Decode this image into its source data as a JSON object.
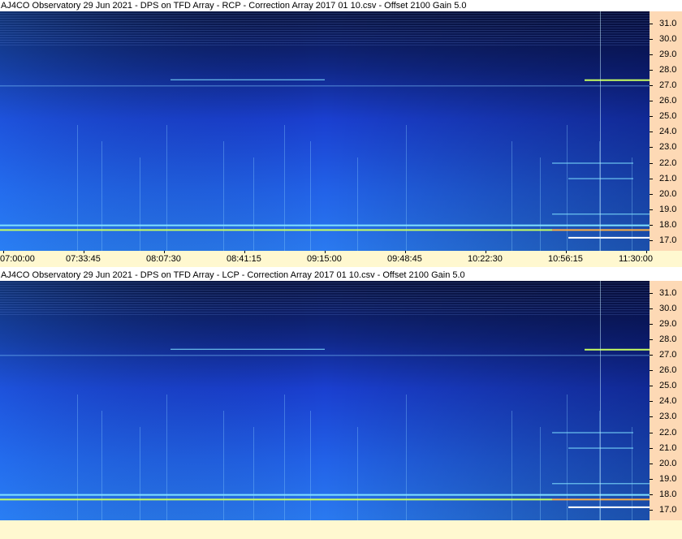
{
  "panels": [
    {
      "title": "AJ4CO Observatory 29 Jun 2021  -  DPS on TFD Array  -  RCP  -  Correction Array 2017 01 10.csv  -  Offset 2100  Gain 5.0",
      "polarization": "RCP"
    },
    {
      "title": "AJ4CO Observatory 29 Jun 2021  -  DPS on TFD Array  -  LCP  -  Correction Array 2017 01 10.csv  -  Offset 2100  Gain 5.0",
      "polarization": "LCP"
    }
  ],
  "colors": {
    "background_dark": "#0a1440",
    "background_mid": "#1a3fd0",
    "background_bright": "#2a7af0",
    "band": "#7fe0ff",
    "band_hot": "#c8ff60",
    "yaxis_bg": "#fdd9b5",
    "xaxis_bg": "#fff8d0"
  },
  "chart_data": [
    {
      "type": "heatmap",
      "title": "AJ4CO Observatory 29 Jun 2021  -  DPS on TFD Array  -  RCP  -  Correction Array 2017 01 10.csv  -  Offset 2100  Gain 5.0",
      "x_tick_labels": [
        "07:00:00",
        "07:33:45",
        "08:07:30",
        "08:41:15",
        "09:15:00",
        "09:48:45",
        "10:22:30",
        "10:56:15",
        "11:30:00"
      ],
      "xlim": [
        "07:00:00",
        "11:30:00"
      ],
      "y_tick_labels": [
        "31.0",
        "30.0",
        "29.0",
        "28.0",
        "27.0",
        "26.0",
        "25.0",
        "24.0",
        "23.0",
        "22.0",
        "21.0",
        "20.0",
        "19.0",
        "18.0",
        "17.0"
      ],
      "ylim": [
        16.3,
        31.8
      ],
      "bands_mhz": [
        27.0,
        27.4,
        18.0,
        17.7,
        17.2,
        21.0,
        22.0,
        18.7
      ],
      "colormap": "dark-blue-to-cyan-yellow"
    },
    {
      "type": "heatmap",
      "title": "AJ4CO Observatory 29 Jun 2021  -  DPS on TFD Array  -  LCP  -  Correction Array 2017 01 10.csv  -  Offset 2100  Gain 5.0",
      "x_tick_labels": [],
      "y_tick_labels": [
        "31.0",
        "30.0",
        "29.0",
        "28.0",
        "27.0",
        "26.0",
        "25.0",
        "24.0",
        "23.0",
        "22.0",
        "21.0",
        "20.0",
        "19.0",
        "18.0",
        "17.0"
      ],
      "ylim": [
        16.3,
        31.8
      ],
      "bands_mhz": [
        27.0,
        27.4,
        18.0,
        17.7,
        17.2,
        21.0,
        22.0,
        18.7
      ],
      "colormap": "dark-blue-to-cyan-yellow"
    }
  ],
  "x_tick_labels": [
    "07:00:00",
    "07:33:45",
    "08:07:30",
    "08:41:15",
    "09:15:00",
    "09:48:45",
    "10:22:30",
    "10:56:15",
    "11:30:00"
  ],
  "y_tick_labels": [
    "31.0",
    "30.0",
    "29.0",
    "28.0",
    "27.0",
    "26.0",
    "25.0",
    "24.0",
    "23.0",
    "22.0",
    "21.0",
    "20.0",
    "19.0",
    "18.0",
    "17.0"
  ]
}
